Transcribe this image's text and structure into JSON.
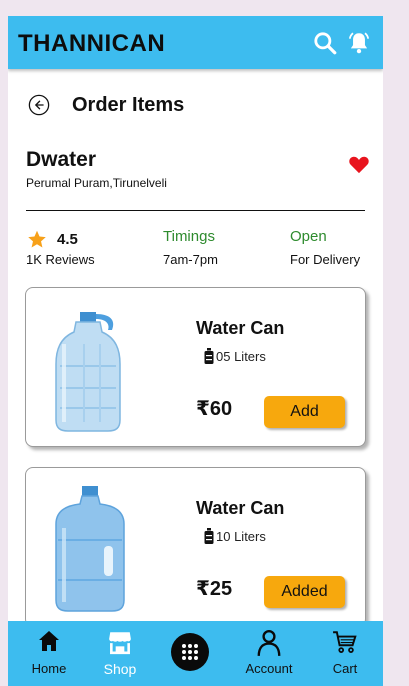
{
  "app": {
    "brand": "THANNICAN"
  },
  "header": {
    "title": "Order Items"
  },
  "store": {
    "name": "Dwater",
    "address": "Perumal Puram,Tirunelveli",
    "rating": "4.5",
    "reviews": "1K Reviews",
    "timings_label": "Timings",
    "timings_value": "7am-7pm",
    "status_label": "Open",
    "status_value": "For Delivery"
  },
  "products": [
    {
      "title": "Water Can",
      "quantity": "05 Liters",
      "price": "₹60",
      "button": "Add"
    },
    {
      "title": "Water Can",
      "quantity": "10 Liters",
      "price": "₹25",
      "button": "Added"
    }
  ],
  "nav": {
    "home": "Home",
    "shop": "Shop",
    "account": "Account",
    "cart": "Cart"
  },
  "colors": {
    "primary": "#3dbcef",
    "button": "#f7a80d",
    "heart": "#e8141e",
    "star": "#f7a11a",
    "green": "#2e8b2e"
  },
  "icons": [
    "search-icon",
    "notification-bell-icon",
    "back-arrow-icon",
    "heart-icon",
    "star-icon",
    "bottle-icon",
    "home-icon",
    "shop-icon",
    "apps-grid-icon",
    "account-icon",
    "cart-icon"
  ]
}
